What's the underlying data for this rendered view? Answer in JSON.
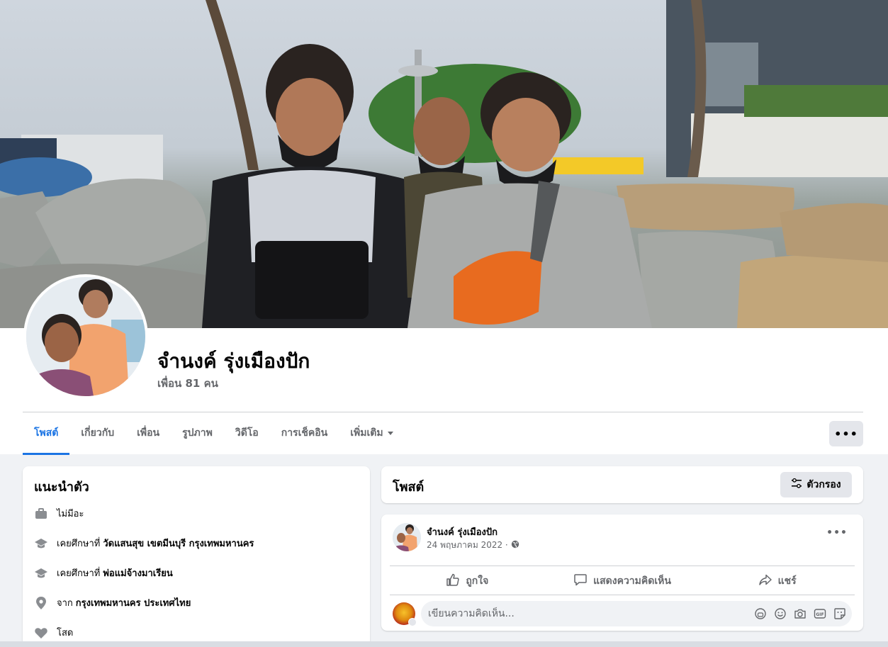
{
  "profile": {
    "name": "จำนงค์ รุ่งเมืองปัก",
    "friends": "เพื่อน 81 คน"
  },
  "tabs": [
    {
      "label": "โพสต์",
      "active": true
    },
    {
      "label": "เกี่ยวกับ"
    },
    {
      "label": "เพื่อน"
    },
    {
      "label": "รูปภาพ"
    },
    {
      "label": "วิดีโอ"
    },
    {
      "label": "การเช็คอิน"
    },
    {
      "label": "เพิ่มเติม"
    }
  ],
  "intro": {
    "title": "แนะนำตัว",
    "work": "ไม่มีอะ",
    "edu1_prefix": "เคยศึกษาที่",
    "edu1_place": "วัดแสนสุข เขตมีนบุรี กรุงเทพมหานคร",
    "edu2_prefix": "เคยศึกษาที่",
    "edu2_place": "พ่อแม่จ้างมาเรียน",
    "from_prefix": "จาก",
    "from_place": "กรุงเทพมหานคร ประเทศไทย",
    "relationship": "โสด"
  },
  "posts": {
    "title": "โพสต์",
    "filter_label": "ตัวกรอง"
  },
  "post": {
    "author": "จำนงค์ รุ่งเมืองปัก",
    "date": "24 พฤษภาคม 2022 ·",
    "like": "ถูกใจ",
    "comment": "แสดงความคิดเห็น",
    "share": "แชร์",
    "comment_placeholder": "เขียนความคิดเห็น..."
  },
  "colors": {
    "accent": "#1b74e4",
    "secondary_text": "#65676b",
    "page_bg": "#f0f2f5"
  }
}
